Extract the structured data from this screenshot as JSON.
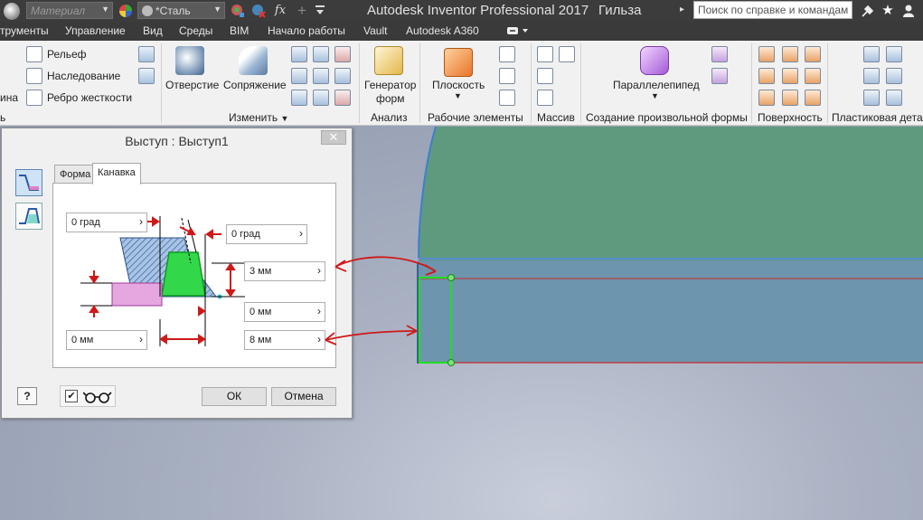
{
  "titlebar": {
    "material_placeholder": "Материал",
    "appearance_value": "*Сталь",
    "fx_label": "fx",
    "app_title": "Autodesk Inventor Professional 2017",
    "document_title": "Гильза",
    "search_placeholder": "Поиск по справке и командам..."
  },
  "ribbon_tabs": [
    "трументы",
    "Управление",
    "Вид",
    "Среды",
    "BIM",
    "Начало работы",
    "Vault",
    "Autodesk A360"
  ],
  "ribbon": {
    "left_cut_1": "ина",
    "left_cut_2": "ь",
    "relief": "Рельеф",
    "inheritance": "Наследование",
    "rib": "Ребро жесткости",
    "hole": "Отверстие",
    "fillet": "Сопряжение",
    "modify_group": "Изменить",
    "shape_generator_1": "Генератор",
    "shape_generator_2": "форм",
    "analysis_group": "Анализ",
    "plane": "Плоскость",
    "work_features_group": "Рабочие элементы",
    "pattern_group": "Массив",
    "box": "Параллелепипед",
    "freeform_group": "Создание произвольной формы",
    "surface_group": "Поверхность",
    "plastic_group": "Пластиковая детал"
  },
  "dialog": {
    "title": "Выступ : Выступ1",
    "close": "✕",
    "tabs": [
      "Форма",
      "Канавка"
    ],
    "fields": {
      "angle_left": "0 град",
      "angle_right": "0 град",
      "height": "3 мм",
      "offset_right": "0 мм",
      "offset_left": "0 мм",
      "width": "8 мм"
    },
    "help_button": "?",
    "ok": "ОК",
    "cancel": "Отмена"
  },
  "colors": {
    "titlebar_bg": "#3c3c3c",
    "ribbon_bg": "#f1f1f1",
    "model_top": "#5d9a7e",
    "model_body": "#6c94ae",
    "edge_red": "#d02020",
    "sketch_green": "#22dd22",
    "annotation_red": "#d01818"
  }
}
